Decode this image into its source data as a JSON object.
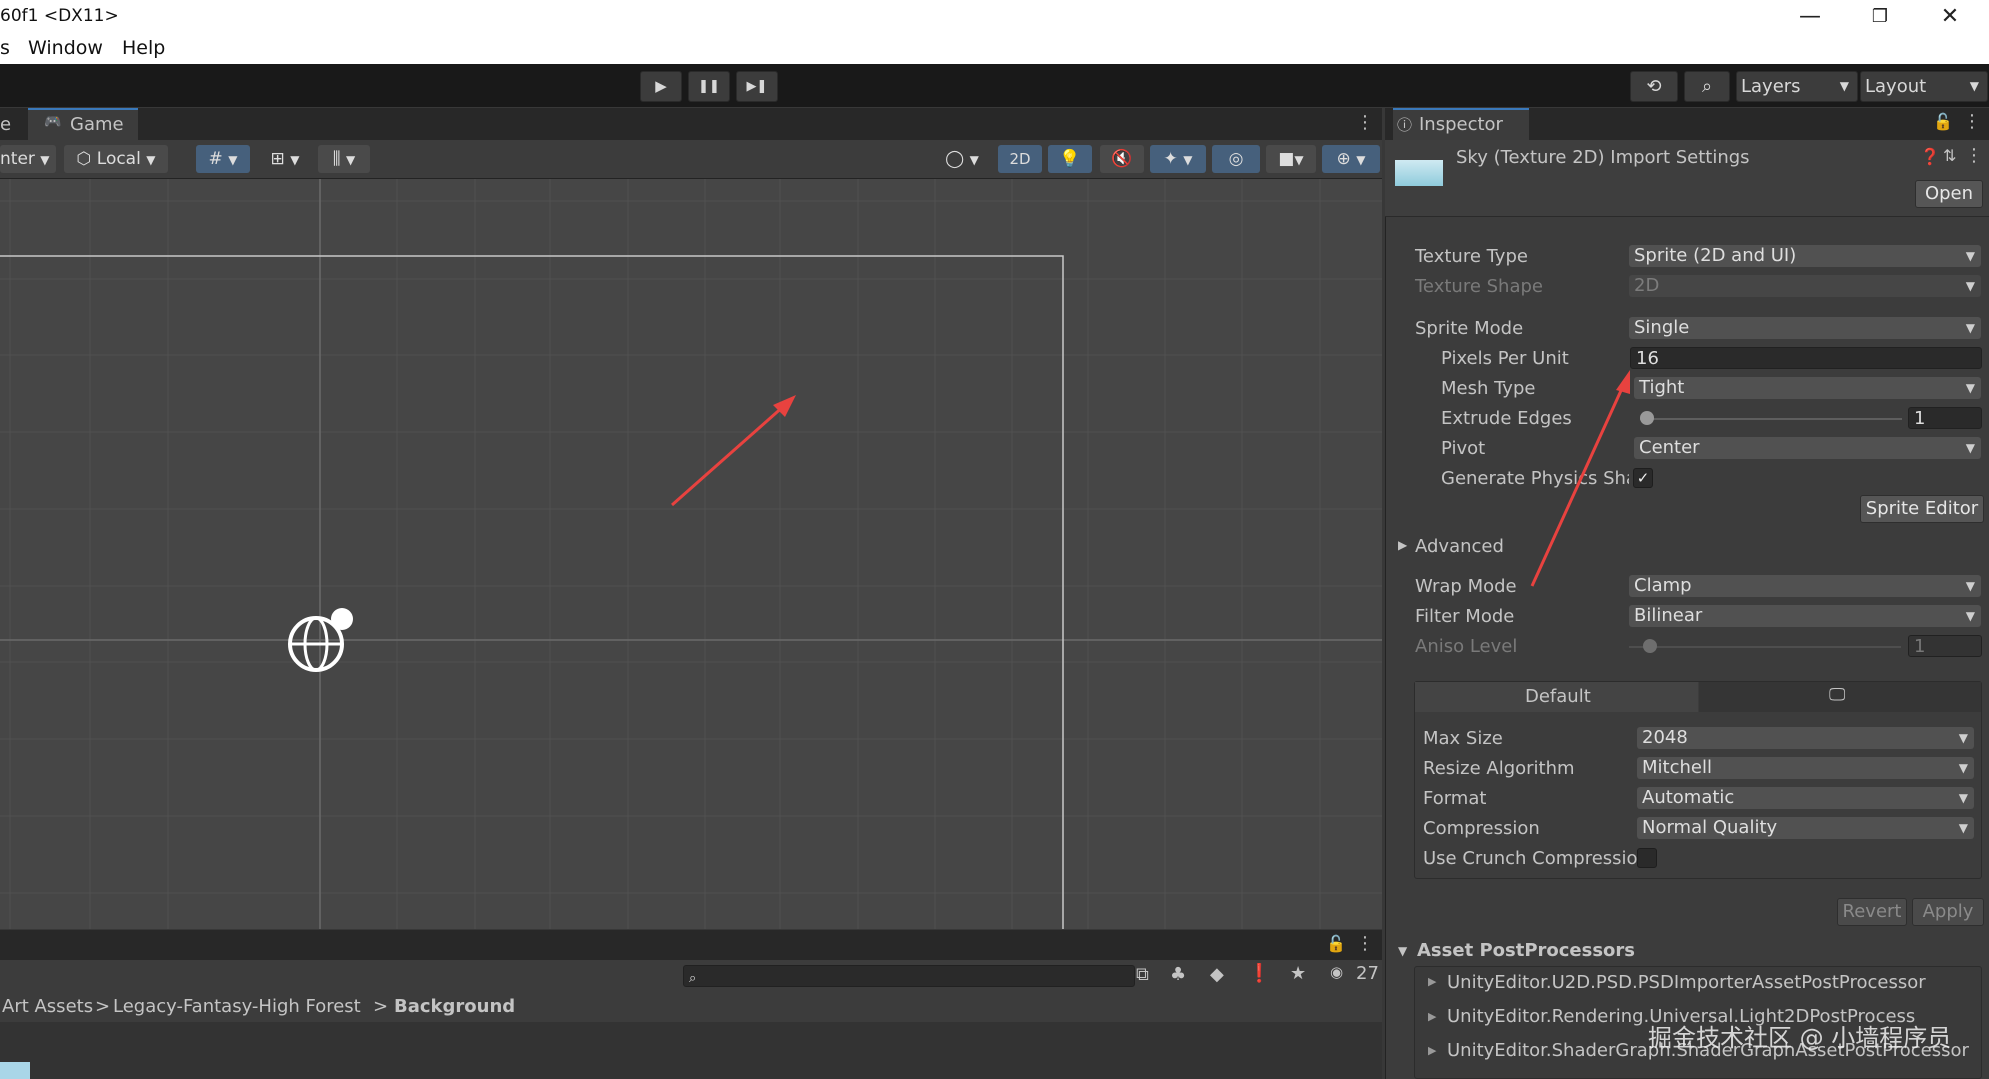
{
  "window": {
    "title": "60f1 <DX11>",
    "min": "—",
    "max": "❐",
    "close": "✕"
  },
  "menu": {
    "partial": "s",
    "window": "Window",
    "help": "Help"
  },
  "toolbar": {
    "play": "▶",
    "pause": "❚❚",
    "step": "▶❚",
    "layers": "Layers",
    "layout": "Layout"
  },
  "scene": {
    "tab_partial": "e",
    "game_tab": "Game",
    "pivot_partial": "nter",
    "local": "Local",
    "mode_2d": "2D"
  },
  "project": {
    "count": "27",
    "breadcrumb": [
      "Art Assets",
      "Legacy-Fantasy-High Forest",
      "Background"
    ],
    "sep": ">"
  },
  "inspector": {
    "tab": "Inspector",
    "title": "Sky (Texture 2D) Import Settings",
    "open": "Open",
    "rows": {
      "texture_type": {
        "label": "Texture Type",
        "value": "Sprite (2D and UI)"
      },
      "texture_shape": {
        "label": "Texture Shape",
        "value": "2D"
      },
      "sprite_mode": {
        "label": "Sprite Mode",
        "value": "Single"
      },
      "pixels_per_unit": {
        "label": "Pixels Per Unit",
        "value": "16"
      },
      "mesh_type": {
        "label": "Mesh Type",
        "value": "Tight"
      },
      "extrude_edges": {
        "label": "Extrude Edges",
        "value": "1"
      },
      "pivot": {
        "label": "Pivot",
        "value": "Center"
      },
      "gen_physics": {
        "label": "Generate Physics Sha",
        "check": "✓"
      },
      "wrap_mode": {
        "label": "Wrap Mode",
        "value": "Clamp"
      },
      "filter_mode": {
        "label": "Filter Mode",
        "value": "Bilinear"
      },
      "aniso_level": {
        "label": "Aniso Level",
        "value": "1"
      }
    },
    "sprite_editor": "Sprite Editor",
    "advanced": "Advanced",
    "platform": {
      "default_tab": "Default",
      "max_size": {
        "label": "Max Size",
        "value": "2048"
      },
      "resize": {
        "label": "Resize Algorithm",
        "value": "Mitchell"
      },
      "format": {
        "label": "Format",
        "value": "Automatic"
      },
      "compression": {
        "label": "Compression",
        "value": "Normal Quality"
      },
      "crunch": {
        "label": "Use Crunch Compressio"
      }
    },
    "revert": "Revert",
    "apply": "Apply",
    "postprocessors": {
      "title": "Asset PostProcessors",
      "items": [
        "UnityEditor.U2D.PSD.PSDImporterAssetPostProcessor",
        "UnityEditor.Rendering.Universal.Light2DPostProcess",
        "UnityEditor.ShaderGraph.ShaderGraphAssetPostProcessor"
      ]
    }
  },
  "watermark": "掘金技术社区 @ 小墙程序员",
  "colors": {
    "arrow": "#e8423f",
    "accent": "#46607c"
  }
}
